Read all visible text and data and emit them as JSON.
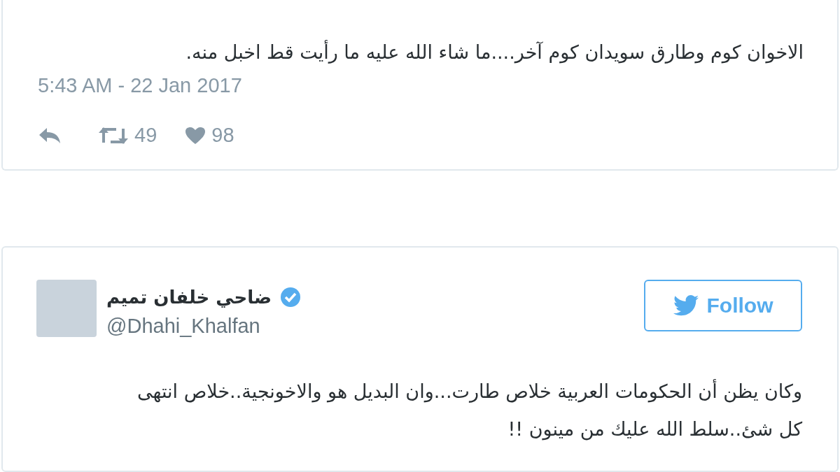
{
  "tweets": [
    {
      "kind": "continued",
      "text": "الاخوان كوم وطارق سويدان كوم آخر....ما شاء الله عليه ما رأيت قط اخبل منه.",
      "timestamp": "5:43 AM - 22 Jan 2017",
      "retweets": "49",
      "likes": "98"
    },
    {
      "kind": "full",
      "author": {
        "name": "ضاحي خلفان تميم",
        "handle": "@Dhahi_Khalfan",
        "verified": true
      },
      "follow_button": "Follow",
      "text_lines": [
        "وكان يظن أن الحكومات العربية خلاص طارت...وان البديل هو والاخونجية..خلاص انتهى",
        "كل شئ..سلط الله عليك من مينون !!"
      ]
    }
  ]
}
